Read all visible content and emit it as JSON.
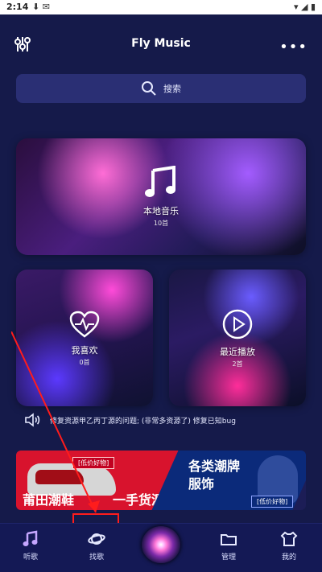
{
  "status": {
    "time": "2:14",
    "left_icons": "⬇ ✉",
    "right_icons": "▾ ◢ ▮"
  },
  "header": {
    "title": "Fly Music",
    "menu_icon": "more-icon",
    "settings_icon": "equalizer-icon"
  },
  "search": {
    "label": "搜索"
  },
  "cards": {
    "local": {
      "title": "本地音乐",
      "subtitle": "10首"
    },
    "like": {
      "title": "我喜欢",
      "subtitle": "0首"
    },
    "recent": {
      "title": "最近播放",
      "subtitle": "2首"
    }
  },
  "notice": {
    "text": "修复资源甲乙丙丁源的问题; (非常多资源了) 修复已知bug"
  },
  "banner": {
    "left_tag": "[低价好物]",
    "left_text1": "莆田潮鞋",
    "left_text2": "一手货源",
    "right_text1": "各类潮牌",
    "right_text2": "服饰",
    "right_tag": "[低价好物]"
  },
  "tabs": [
    {
      "label": "听歌"
    },
    {
      "label": "找歌"
    },
    {
      "label": ""
    },
    {
      "label": "管理"
    },
    {
      "label": "我的"
    }
  ],
  "colors": {
    "bg": "#151a4a",
    "accent": "#2a2f74",
    "annotation": "#ff1c1c"
  }
}
